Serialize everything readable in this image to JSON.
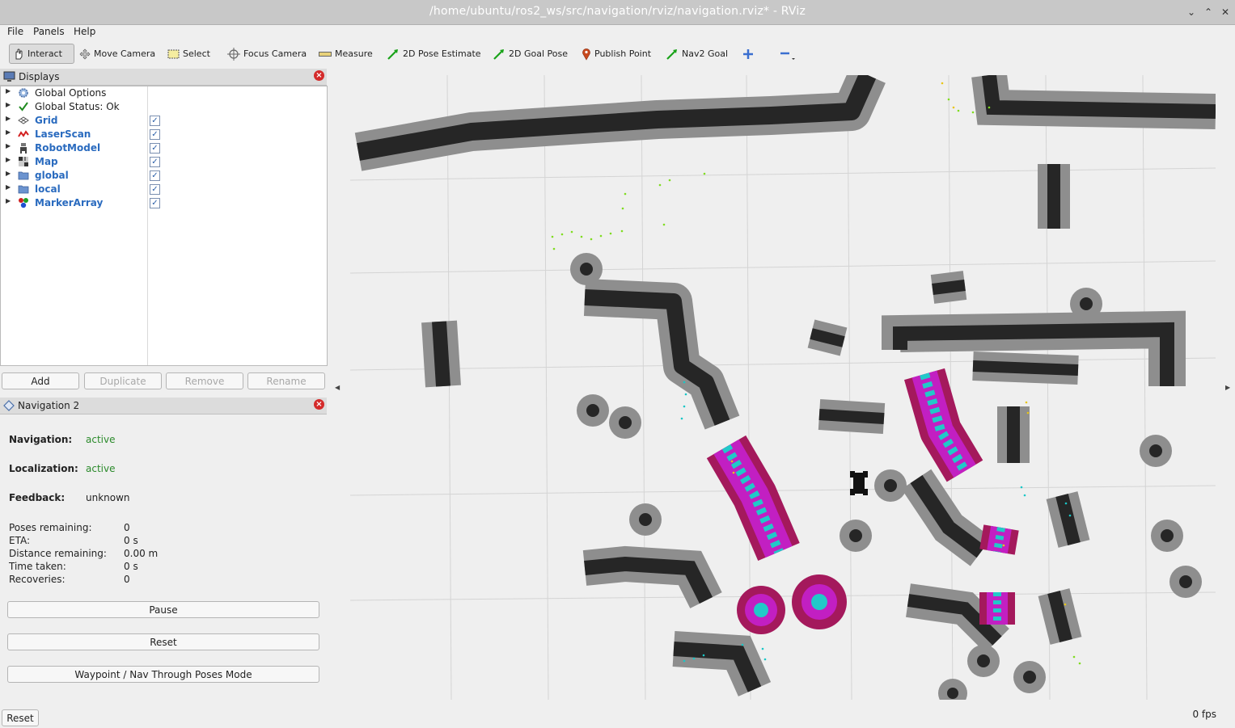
{
  "window": {
    "title": "/home/ubuntu/ros2_ws/src/navigation/rviz/navigation.rviz* - RViz"
  },
  "menu": [
    "File",
    "Panels",
    "Help"
  ],
  "toolbar": {
    "tools": [
      {
        "label": "Interact",
        "icon": "hand-icon",
        "active": true
      },
      {
        "label": "Move Camera",
        "icon": "move-camera-icon"
      },
      {
        "label": "Select",
        "icon": "select-icon"
      },
      {
        "label": "Focus Camera",
        "icon": "focus-camera-icon"
      },
      {
        "label": "Measure",
        "icon": "ruler-icon"
      },
      {
        "label": "2D Pose Estimate",
        "icon": "green-arrow-icon"
      },
      {
        "label": "2D Goal Pose",
        "icon": "green-arrow-icon"
      },
      {
        "label": "Publish Point",
        "icon": "map-pin-icon"
      },
      {
        "label": "Nav2 Goal",
        "icon": "green-arrow-icon"
      }
    ]
  },
  "displays": {
    "title": "Displays",
    "items": [
      {
        "label": "Global Options",
        "icon": "gear-icon",
        "bold": false
      },
      {
        "label": "Global Status: Ok",
        "icon": "checkmark-icon",
        "bold": false
      },
      {
        "label": "Grid",
        "icon": "grid-icon",
        "bold": true,
        "checked": true
      },
      {
        "label": "LaserScan",
        "icon": "laserscan-icon",
        "bold": true,
        "checked": true
      },
      {
        "label": "RobotModel",
        "icon": "robot-icon",
        "bold": true,
        "checked": true
      },
      {
        "label": "Map",
        "icon": "map-icon",
        "bold": true,
        "checked": true
      },
      {
        "label": "global",
        "icon": "folder-icon",
        "bold": true,
        "checked": true
      },
      {
        "label": "local",
        "icon": "folder-icon",
        "bold": true,
        "checked": true
      },
      {
        "label": "MarkerArray",
        "icon": "marker-icon",
        "bold": true,
        "checked": true
      }
    ],
    "buttons": {
      "add": "Add",
      "duplicate": "Duplicate",
      "remove": "Remove",
      "rename": "Rename"
    }
  },
  "nav2": {
    "title": "Navigation 2",
    "navigation_label": "Navigation:",
    "navigation_value": "active",
    "localization_label": "Localization:",
    "localization_value": "active",
    "feedback_label": "Feedback:",
    "feedback_value": "unknown",
    "stats": [
      {
        "label": "Poses remaining:",
        "value": "0"
      },
      {
        "label": "ETA:",
        "value": "0 s"
      },
      {
        "label": "Distance remaining:",
        "value": "0.00 m"
      },
      {
        "label": "Time taken:",
        "value": "0 s"
      },
      {
        "label": "Recoveries:",
        "value": "0"
      }
    ],
    "pause": "Pause",
    "reset": "Reset",
    "mode": "Waypoint / Nav Through Poses Mode"
  },
  "status": {
    "reset": "Reset",
    "fps": "0 fps"
  }
}
